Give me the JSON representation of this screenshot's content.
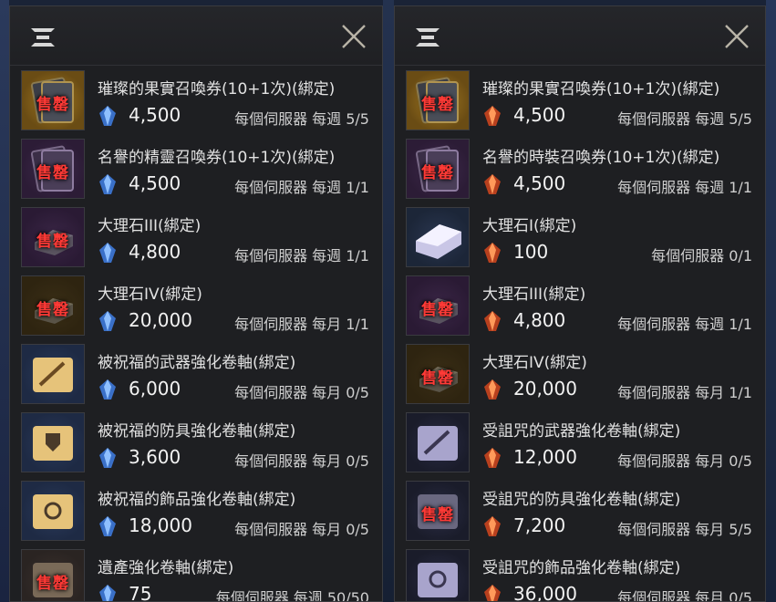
{
  "left_panel": {
    "icons": {
      "menu": "menu-icon",
      "close": "close-icon"
    },
    "items": [
      {
        "name": "璀璨的果實召喚券(10+1次)(綁定)",
        "price": "4,500",
        "limit": "每個伺服器 每週 5/5",
        "sold_out": "售罄",
        "icon": "card-pack",
        "currency": "blue-crystal"
      },
      {
        "name": "名譽的精靈召喚券(10+1次)(綁定)",
        "price": "4,500",
        "limit": "每個伺服器 每週 1/1",
        "sold_out": "售罄",
        "icon": "card-pack-purple",
        "currency": "blue-crystal"
      },
      {
        "name": "大理石III(綁定)",
        "price": "4,800",
        "limit": "每個伺服器 每週 1/1",
        "sold_out": "售罄",
        "icon": "marble",
        "currency": "blue-crystal"
      },
      {
        "name": "大理石IV(綁定)",
        "price": "20,000",
        "limit": "每個伺服器 每月 1/1",
        "sold_out": "售罄",
        "icon": "marble-gold",
        "currency": "blue-crystal"
      },
      {
        "name": "被祝福的武器強化卷軸(綁定)",
        "price": "6,000",
        "limit": "每個伺服器 每月 0/5",
        "sold_out": "",
        "icon": "scroll-weapon",
        "currency": "blue-crystal"
      },
      {
        "name": "被祝福的防具強化卷軸(綁定)",
        "price": "3,600",
        "limit": "每個伺服器 每月 0/5",
        "sold_out": "",
        "icon": "scroll-armor",
        "currency": "blue-crystal"
      },
      {
        "name": "被祝福的飾品強化卷軸(綁定)",
        "price": "18,000",
        "limit": "每個伺服器 每月 0/5",
        "sold_out": "",
        "icon": "scroll-accessory",
        "currency": "blue-crystal"
      },
      {
        "name": "遺產強化卷軸(綁定)",
        "price": "75",
        "limit": "每個伺服器 每週 50/50",
        "sold_out": "售罄",
        "icon": "scroll-legacy",
        "currency": "blue-crystal"
      }
    ]
  },
  "right_panel": {
    "icons": {
      "menu": "menu-icon",
      "close": "close-icon"
    },
    "items": [
      {
        "name": "璀璨的果實召喚券(10+1次)(綁定)",
        "price": "4,500",
        "limit": "每個伺服器 每週 5/5",
        "sold_out": "售罄",
        "icon": "card-pack",
        "currency": "red-crystal"
      },
      {
        "name": "名譽的時裝召喚券(10+1次)(綁定)",
        "price": "4,500",
        "limit": "每個伺服器 每週 1/1",
        "sold_out": "售罄",
        "icon": "card-pack-purple",
        "currency": "red-crystal"
      },
      {
        "name": "大理石I(綁定)",
        "price": "100",
        "limit": "每個伺服器 0/1",
        "sold_out": "",
        "icon": "marble-white",
        "currency": "red-crystal"
      },
      {
        "name": "大理石III(綁定)",
        "price": "4,800",
        "limit": "每個伺服器 每週 1/1",
        "sold_out": "售罄",
        "icon": "marble",
        "currency": "red-crystal"
      },
      {
        "name": "大理石IV(綁定)",
        "price": "20,000",
        "limit": "每個伺服器 每月 1/1",
        "sold_out": "售罄",
        "icon": "marble-gold",
        "currency": "red-crystal"
      },
      {
        "name": "受詛咒的武器強化卷軸(綁定)",
        "price": "12,000",
        "limit": "每個伺服器 每月 0/5",
        "sold_out": "",
        "icon": "cursed-scroll-weapon",
        "currency": "red-crystal"
      },
      {
        "name": "受詛咒的防具強化卷軸(綁定)",
        "price": "7,200",
        "limit": "每個伺服器 每月 5/5",
        "sold_out": "售罄",
        "icon": "cursed-scroll-armor",
        "currency": "red-crystal"
      },
      {
        "name": "受詛咒的飾品強化卷軸(綁定)",
        "price": "36,000",
        "limit": "每個伺服器 每月 0/5",
        "sold_out": "",
        "icon": "cursed-scroll-accessory",
        "currency": "red-crystal"
      }
    ]
  },
  "colors": {
    "sold_out": "#ff3a36",
    "text": "#e2e2e2",
    "panel_bg": "#1e1f22",
    "blue_crystal": "#4d8fe8",
    "red_crystal": "#d9532b"
  }
}
